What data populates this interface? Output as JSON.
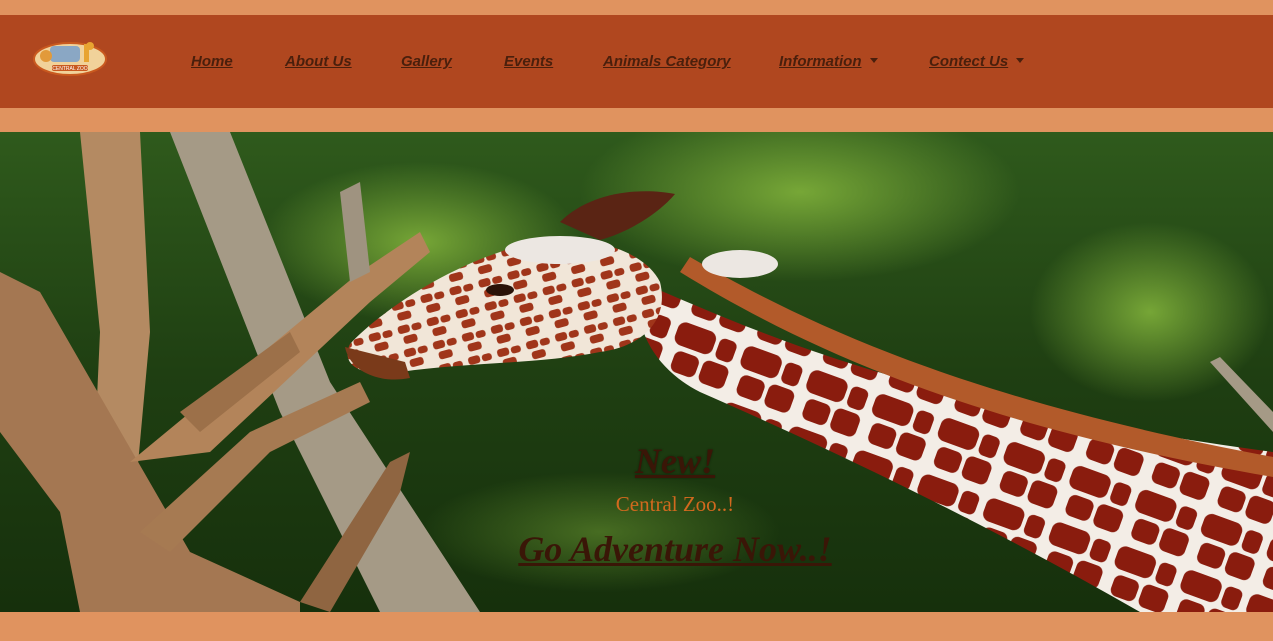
{
  "navbar": {
    "logo_icon": "central-zoo-logo",
    "logo_text": "CENTRAL ZOO",
    "items": [
      {
        "label": "Home",
        "dropdown": false
      },
      {
        "label": "About Us",
        "dropdown": false
      },
      {
        "label": "Gallery",
        "dropdown": false
      },
      {
        "label": "Events",
        "dropdown": false
      },
      {
        "label": "Animals Category",
        "dropdown": false
      },
      {
        "label": "Information",
        "dropdown": true
      },
      {
        "label": "Contect Us",
        "dropdown": true
      }
    ]
  },
  "hero": {
    "image_icon": "giraffe-hero-image",
    "heading": "New!",
    "subheading": "Central Zoo..!",
    "cta": "Go Adventure Now..!"
  },
  "colors": {
    "band": "#e0935f",
    "navbar": "#b0471f",
    "nav_text": "#4a1f0c",
    "caption_dark": "#3a1607",
    "caption_orange": "#d2691e"
  }
}
